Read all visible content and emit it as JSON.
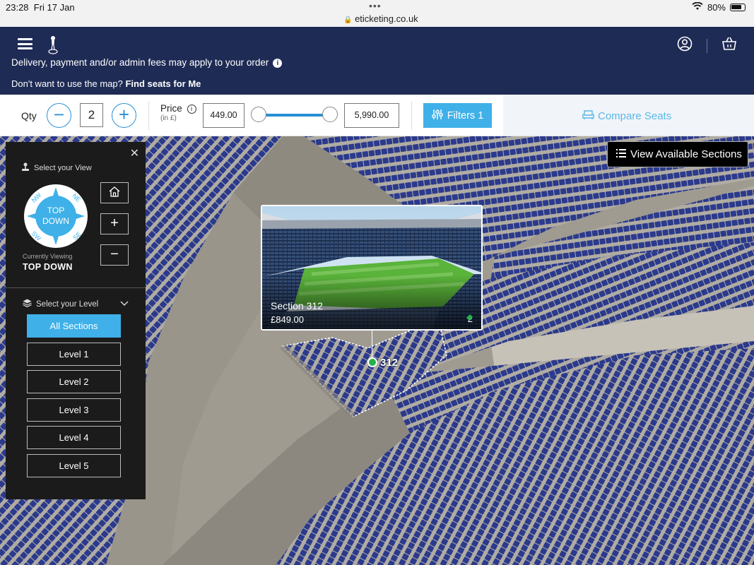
{
  "status": {
    "time": "23:28",
    "date": "Fri 17 Jan",
    "url": "eticketing.co.uk",
    "battery": "80%"
  },
  "nav": {
    "delivery_text": "Delivery, payment and/or admin fees may apply to your order",
    "find_prefix": "Don't want to use the map?",
    "find_link": "Find seats for Me"
  },
  "filter": {
    "qty_label": "Qty",
    "qty_value": "2",
    "price_label": "Price",
    "price_unit": "(in £)",
    "price_min": "449.00",
    "price_max": "5,990.00",
    "filters_label": "Filters 1",
    "compare_label": "Compare Seats"
  },
  "map": {
    "view_sections_label": "View Available Sections"
  },
  "panel": {
    "select_view": "Select your View",
    "compass": {
      "center": "TOP\nDOWN",
      "nw": "NW",
      "ne": "NE",
      "sw": "SW",
      "se": "SE"
    },
    "currently_label": "Currently Viewing",
    "currently_value": "TOP DOWN",
    "select_level": "Select your Level",
    "levels": [
      "All Sections",
      "Level 1",
      "Level 2",
      "Level 3",
      "Level 4",
      "Level 5"
    ]
  },
  "popup": {
    "section": "Section 312",
    "price": "£849.00",
    "available": "2",
    "pin_label": "312"
  },
  "colors": {
    "navy": "#1e2b55",
    "accent": "#3fb0e8",
    "seat": "#2b3a8c",
    "available": "#28b04a"
  }
}
